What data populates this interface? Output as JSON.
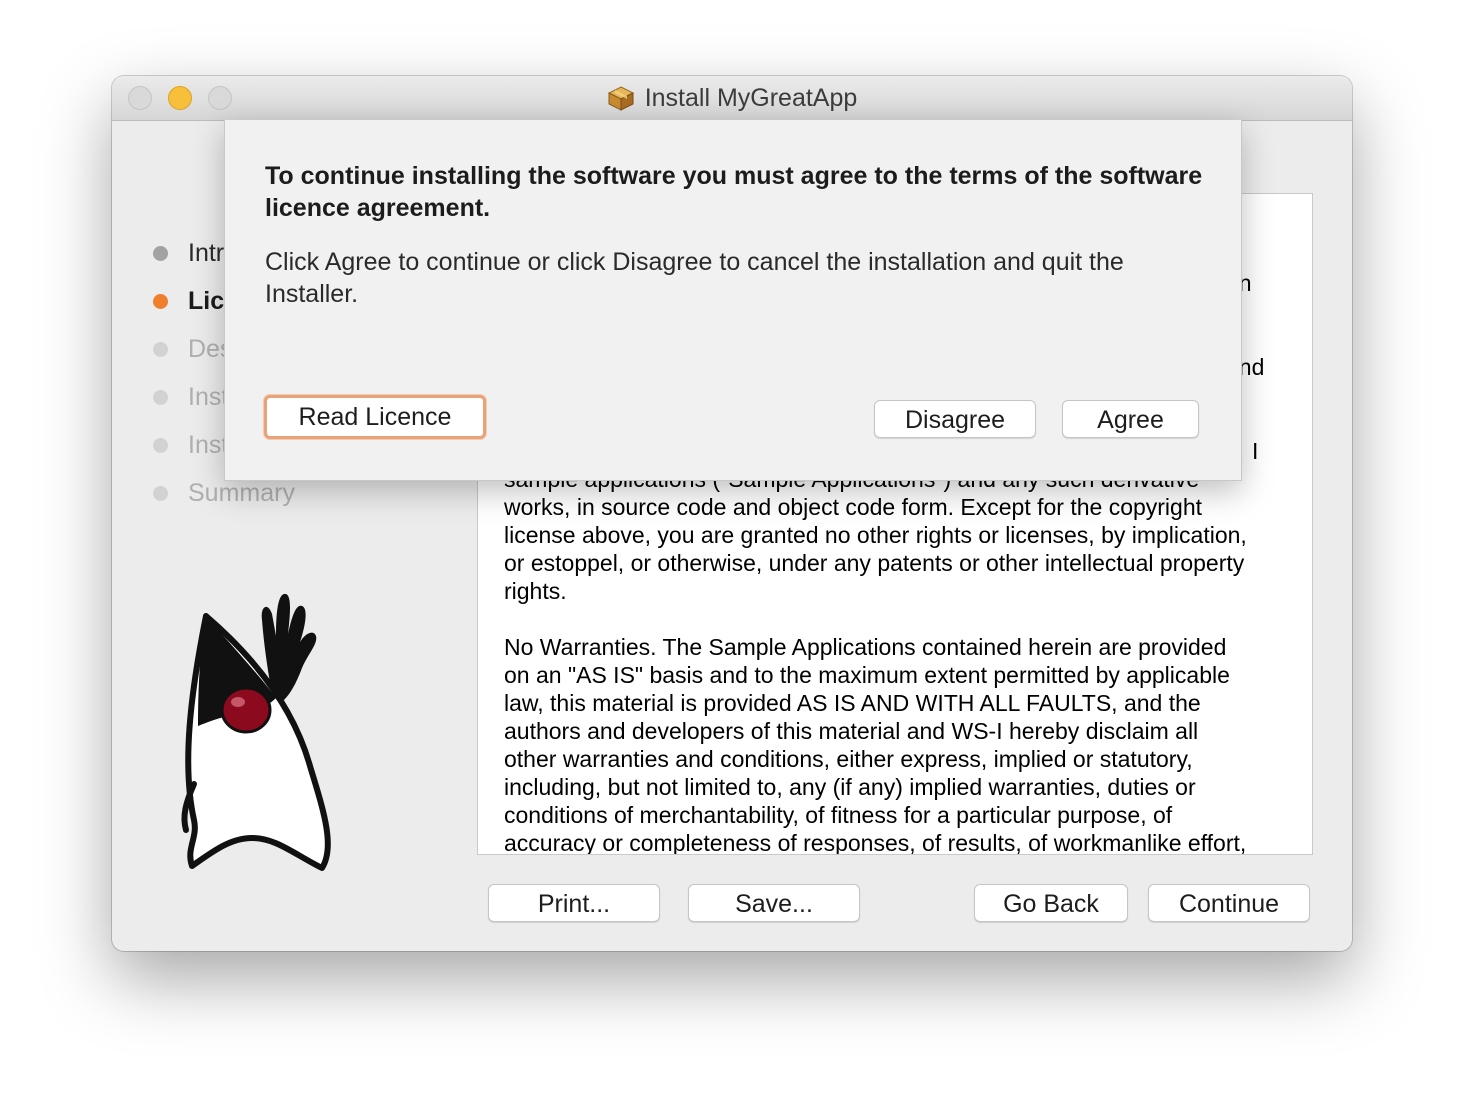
{
  "window": {
    "title": "Install MyGreatApp",
    "traffic_lights": [
      "close",
      "minimize",
      "zoom"
    ]
  },
  "steps": [
    {
      "label": "Introduction",
      "state": "done"
    },
    {
      "label": "Licence",
      "state": "current"
    },
    {
      "label": "Destination Select",
      "state": "future"
    },
    {
      "label": "Installation Type",
      "state": "future"
    },
    {
      "label": "Installation",
      "state": "future"
    },
    {
      "label": "Summary",
      "state": "future"
    }
  ],
  "licence": {
    "partial_lines": [
      "on",
      "and",
      "I"
    ],
    "paragraphs": [
      "sample applications (\"Sample Applications\") and any such derivative\nworks, in source code and object code form.  Except for the copyright\nlicense above, you are granted no other rights or licenses, by implication,\nor estoppel, or otherwise, under any patents or other intellectual property\nrights.",
      "No Warranties.  The Sample Applications contained herein are provided\non an \"AS IS\" basis and to the maximum extent permitted by applicable\nlaw, this material is provided AS IS AND WITH ALL FAULTS, and the\nauthors and developers of this material and WS-I hereby disclaim all\nother warranties and conditions, either express, implied or statutory,\nincluding, but not limited to, any (if any) implied warranties, duties or\nconditions of merchantability, of fitness for a particular purpose, of\naccuracy or completeness of responses, of results, of workmanlike effort,"
    ]
  },
  "buttons": {
    "print": "Print...",
    "save": "Save...",
    "go_back": "Go Back",
    "continue": "Continue"
  },
  "sheet": {
    "heading": "To continue installing the software you must agree to the terms of the software licence agreement.",
    "body": "Click Agree to continue or click Disagree to cancel the installation and quit the Installer.",
    "read_licence": "Read Licence",
    "disagree": "Disagree",
    "agree": "Agree"
  },
  "colors": {
    "current_step": "#f07f2d",
    "focus_ring": "#e8a37a",
    "minimize_light": "#f8c03a"
  }
}
